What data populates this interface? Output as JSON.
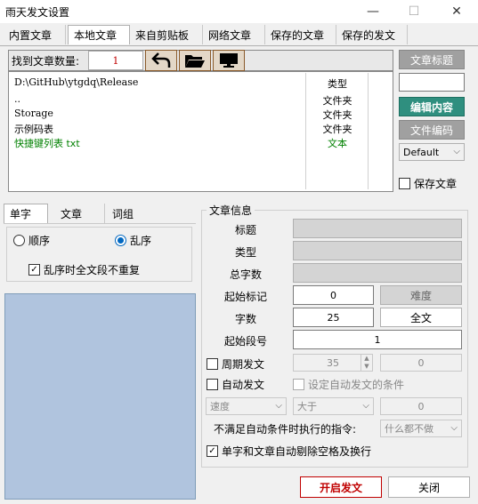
{
  "window": {
    "title": "雨天发文设置",
    "minimize": "—",
    "maximize": "☐",
    "close": "✕"
  },
  "tabs": [
    "内置文章",
    "本地文章",
    "来自剪贴板",
    "网络文章",
    "保存的文章",
    "保存的发文"
  ],
  "found": {
    "label": "找到文章数量:",
    "count": "1"
  },
  "list": {
    "header_type": "类型",
    "path": "D:\\GitHub\\ytgdq\\Release",
    "rows": [
      {
        "name": "..",
        "type": "文件夹"
      },
      {
        "name": "Storage",
        "type": "文件夹"
      },
      {
        "name": "示例码表",
        "type": "文件夹"
      },
      {
        "name": "快捷键列表 txt",
        "type": "文本"
      }
    ]
  },
  "right": {
    "title_btn": "文章标题",
    "edit_btn": "编辑内容",
    "encoding_btn": "文件编码",
    "encoding_value": "Default",
    "save_article": "保存文章"
  },
  "mode_tabs": [
    "单字",
    "文章",
    "词组"
  ],
  "order": {
    "sequential": "顺序",
    "random": "乱序",
    "no_repeat": "乱序时全文段不重复"
  },
  "info": {
    "group": "文章信息",
    "title_lbl": "标题",
    "type_lbl": "类型",
    "total_lbl": "总字数",
    "start_mark_lbl": "起始标记",
    "start_mark_val": "0",
    "difficulty_btn": "难度",
    "chars_lbl": "字数",
    "chars_val": "25",
    "fulltext_btn": "全文",
    "start_para_lbl": "起始段号",
    "start_para_val": "1",
    "periodic": "周期发文",
    "periodic_val": "35",
    "periodic_val2": "0",
    "auto": "自动发文",
    "auto_cond": "设定自动发文的条件",
    "speed": "速度",
    "greater": "大于",
    "speed_val": "0",
    "unmet_lbl": "不满足自动条件时执行的指令:",
    "unmet_val": "什么都不做",
    "strip_ws": "单字和文章自动剔除空格及换行"
  },
  "footer": {
    "start": "开启发文",
    "close": "关闭"
  },
  "colors": {
    "accent_red": "#c00000",
    "teal": "#2f8f7f",
    "preview_bg": "#b0c4de",
    "green_text": "#008000"
  }
}
